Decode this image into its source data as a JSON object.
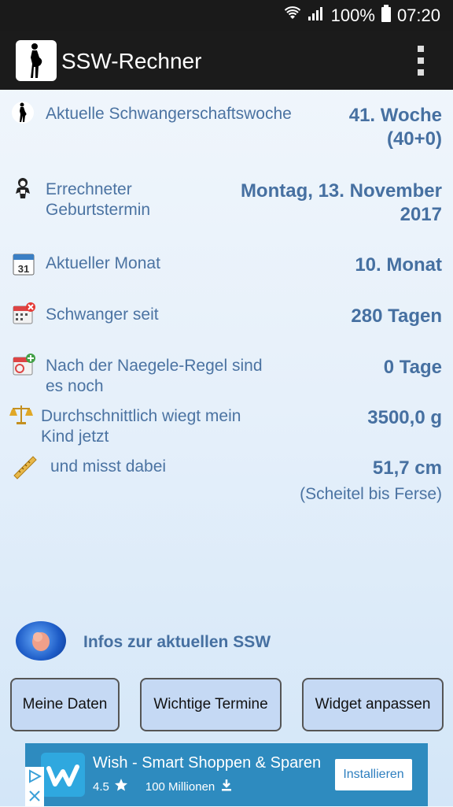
{
  "status": {
    "battery": "100%",
    "time": "07:20"
  },
  "appbar": {
    "title": "SSW-Rechner"
  },
  "rows": [
    {
      "label": "Aktuelle Schwangerschaftswoche",
      "value": "41. Woche",
      "value2": "(40+0)"
    },
    {
      "label": "Errechneter Geburtstermin",
      "value": "Montag, 13. November",
      "value2": "2017"
    },
    {
      "label": "Aktueller Monat",
      "value": "10. Monat"
    },
    {
      "label": "Schwanger seit",
      "value": "280 Tagen"
    },
    {
      "label": "Nach der Naegele-Regel sind es noch",
      "value": "0 Tage"
    },
    {
      "label": "Durchschnittlich wiegt mein Kind jetzt",
      "value": "3500,0 g"
    },
    {
      "label": "und misst dabei",
      "value": "51,7 cm",
      "sub": "(Scheitel bis Ferse)"
    }
  ],
  "info": {
    "label": "Infos zur aktuellen SSW"
  },
  "buttons": {
    "my_data": "Meine Daten",
    "important_dates": "Wichtige Termine",
    "widget": "Widget anpassen"
  },
  "ad": {
    "title": "Wish - Smart Shoppen & Sparen",
    "rating": "4.5",
    "downloads": "100 Millionen",
    "install": "Installieren",
    "brand_color": "#2e8bbf"
  },
  "colors": {
    "accent_text": "#4670a1",
    "label_text": "#4b73a2",
    "button_bg": "#c5d9f4"
  },
  "calendar_icon_day": "31"
}
